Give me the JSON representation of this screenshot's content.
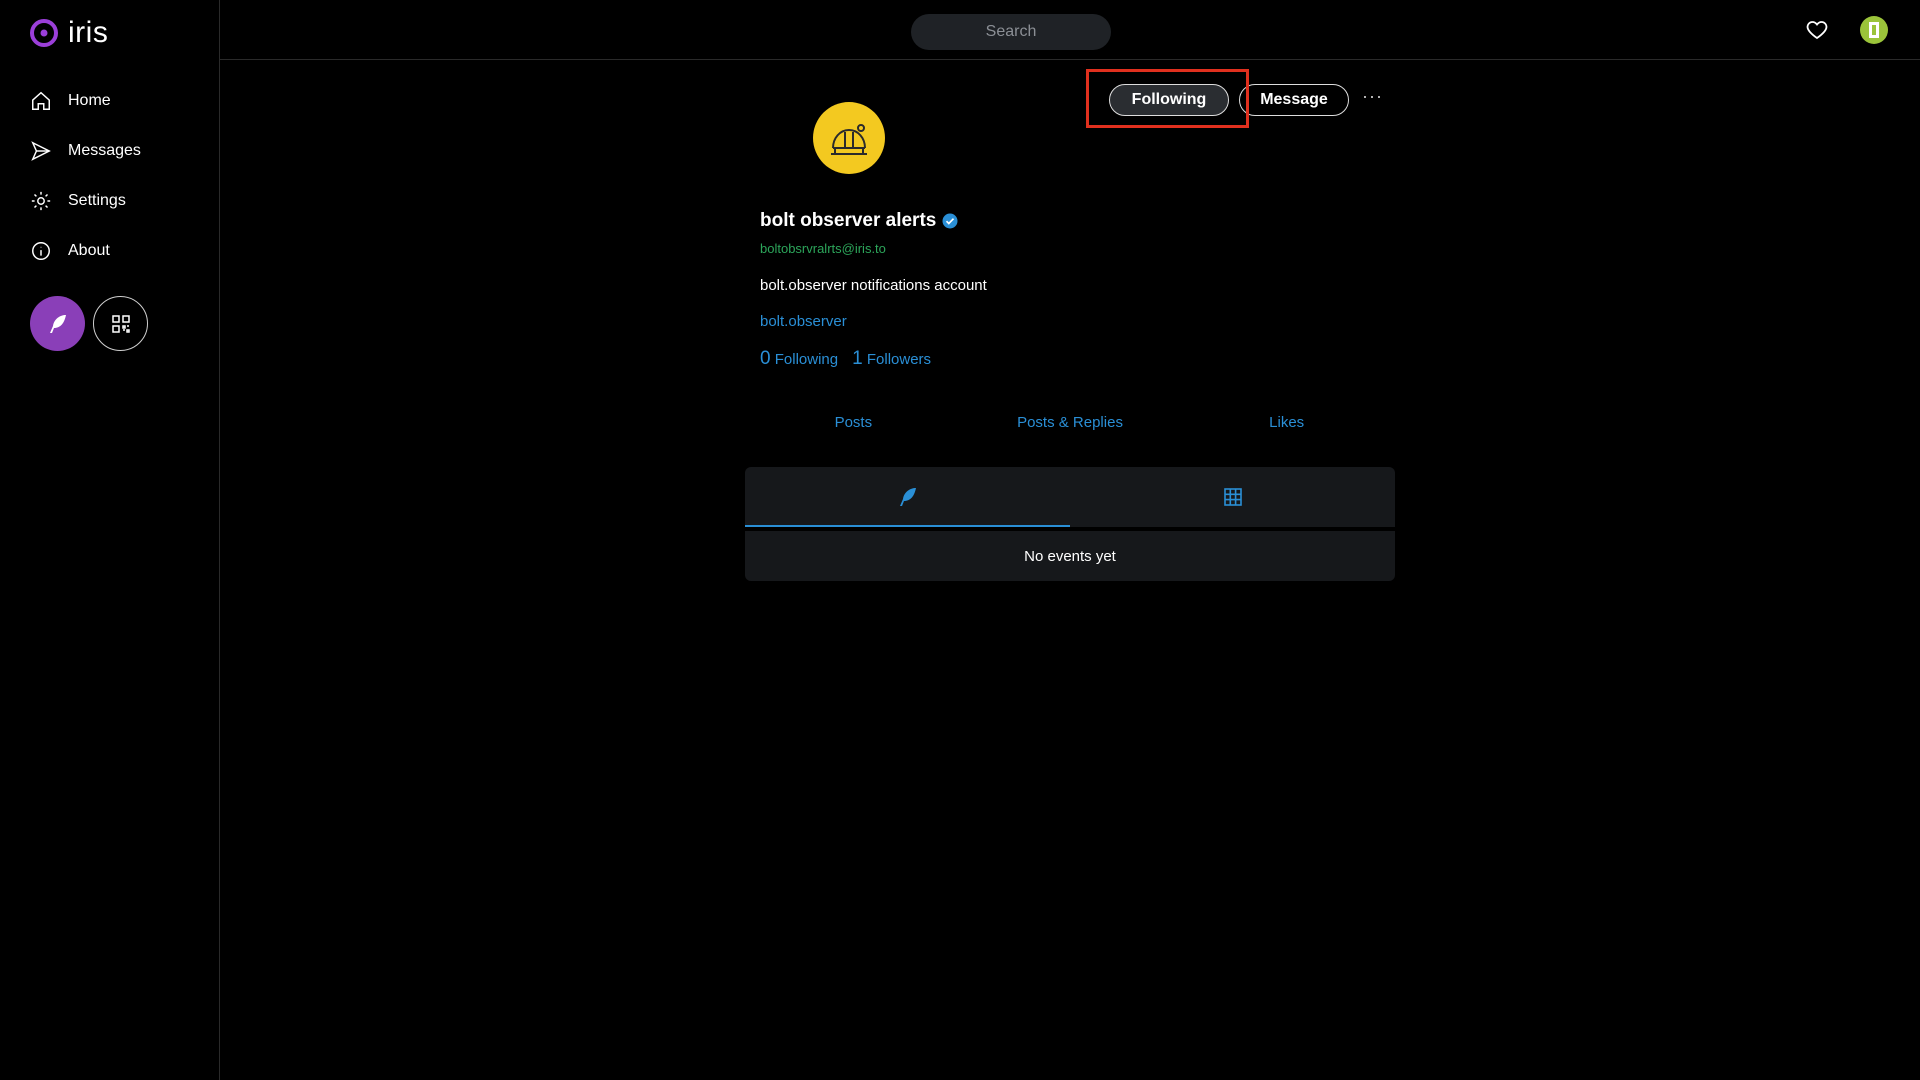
{
  "app": {
    "name": "iris"
  },
  "sidebar": {
    "items": [
      {
        "label": "Home",
        "icon": "home-icon"
      },
      {
        "label": "Messages",
        "icon": "send-icon"
      },
      {
        "label": "Settings",
        "icon": "gear-icon"
      },
      {
        "label": "About",
        "icon": "info-icon"
      }
    ]
  },
  "header": {
    "search_placeholder": "Search"
  },
  "profile": {
    "name": "bolt observer alerts",
    "nip05": "boltobsrvralrts@iris.to",
    "bio": "bolt.observer notifications account",
    "website": "bolt.observer",
    "following_count": "0",
    "following_label": "Following",
    "followers_count": "1",
    "followers_label": "Followers",
    "follow_button": "Following",
    "message_button": "Message",
    "more": "···"
  },
  "tabs": [
    "Posts",
    "Posts & Replies",
    "Likes"
  ],
  "feed": {
    "empty_text": "No events yet"
  },
  "colors": {
    "accent": "#2a8fd6",
    "brand": "#8a3fb8",
    "avatar": "#f3c920",
    "highlight": "#e0301e"
  }
}
